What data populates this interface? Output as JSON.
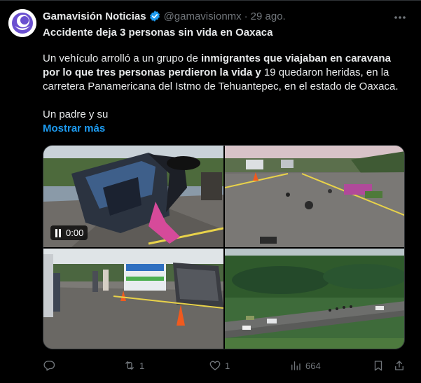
{
  "author": {
    "name": "Gamavisión Noticias",
    "handle": "@gamavisionmx",
    "separator": "·",
    "date": "29 ago.",
    "avatar_icon": "gamavision-logo-icon",
    "verified_icon": "verified-badge-icon"
  },
  "tweet": {
    "headline": "Accidente deja 3 personas sin vida en Oaxaca",
    "p1_a": "Un vehículo arrolló a un grupo de ",
    "p1_b": "inmigrantes que viajaban en caravana por lo que tres personas perdieron la vida y",
    "p1_c": " 19 quedaron heridas, en la carretera Panamericana del Istmo de Tehuantepec, en el estado de Oaxaca.",
    "p2": "Un padre y su",
    "show_more": "Mostrar más"
  },
  "media": {
    "video_time": "0:00",
    "images": [
      {
        "name": "crashed-van-photo"
      },
      {
        "name": "highway-debris-photo"
      },
      {
        "name": "police-cones-photo"
      },
      {
        "name": "aerial-highway-photo"
      }
    ]
  },
  "actions": {
    "reply_icon": "reply-icon",
    "retweet_icon": "retweet-icon",
    "retweet_count": "1",
    "like_icon": "heart-icon",
    "like_count": "1",
    "views_icon": "views-icon",
    "views_count": "664",
    "bookmark_icon": "bookmark-icon",
    "share_icon": "share-icon"
  },
  "colors": {
    "background": "#000000",
    "text": "#e7e9ea",
    "muted": "#71767b",
    "accent": "#1d9bf0"
  }
}
